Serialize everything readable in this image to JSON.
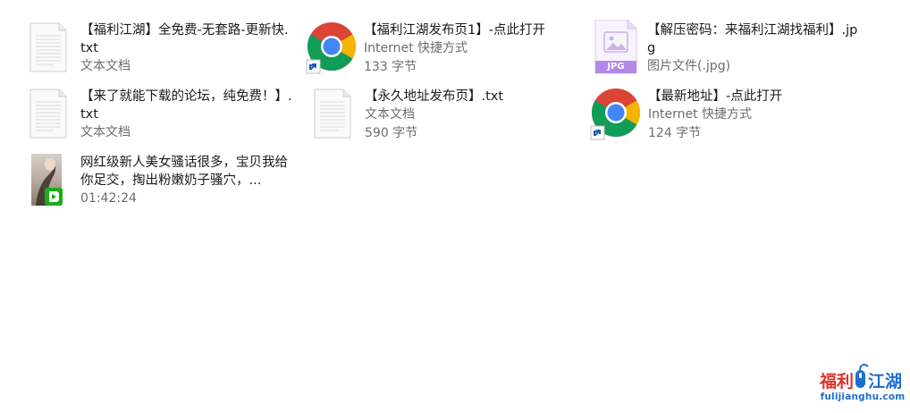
{
  "files": [
    {
      "name": "【福利江湖】全免费-无套路-更新快.txt",
      "type": "文本文档",
      "size": "",
      "icon": "text-document-icon"
    },
    {
      "name": "【福利江湖发布页1】-点此打开",
      "type": "Internet 快捷方式",
      "size": "133 字节",
      "icon": "chrome-shortcut-icon"
    },
    {
      "name": "【解压密码：来福利江湖找福利】.jpg",
      "type": "图片文件(.jpg)",
      "size": "",
      "icon": "jpg-file-icon",
      "badge": "JPG"
    },
    {
      "name": "【来了就能下载的论坛，纯免费！】.txt",
      "type": "文本文档",
      "size": "",
      "icon": "text-document-icon"
    },
    {
      "name": "【永久地址发布页】.txt",
      "type": "文本文档",
      "size": "590 字节",
      "icon": "text-document-icon"
    },
    {
      "name": "【最新地址】-点此打开",
      "type": "Internet 快捷方式",
      "size": "124 字节",
      "icon": "chrome-shortcut-icon"
    },
    {
      "name": "网红级新人美女骚话很多，宝贝我给你足交，掏出粉嫩奶子骚穴，...",
      "type": "01:42:24",
      "size": "",
      "icon": "video-thumbnail-icon"
    }
  ],
  "watermark": {
    "logo": "福利江湖",
    "text": "fulijianghu.com"
  },
  "colors": {
    "chrome_red": "#db4437",
    "chrome_green": "#0f9d58",
    "chrome_yellow": "#f4b400",
    "chrome_blue": "#4285f4",
    "jpg_purple": "#b389e6",
    "video_green": "#1aad19"
  }
}
